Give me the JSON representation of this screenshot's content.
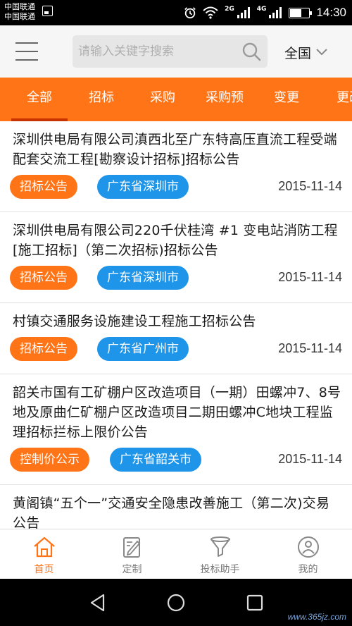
{
  "status_bar": {
    "carrier_1": "中国联通",
    "carrier_2": "中国联通",
    "network_1": "2G",
    "network_2": "4G",
    "battery_level": 0.55,
    "time": "14:30"
  },
  "header": {
    "search_placeholder": "请输入关键字搜索",
    "region": "全国"
  },
  "tabs": [
    {
      "label": "全部",
      "active": true
    },
    {
      "label": "招标",
      "active": false
    },
    {
      "label": "采购",
      "active": false
    },
    {
      "label": "采购预",
      "active": false
    },
    {
      "label": "变更",
      "active": false
    },
    {
      "label": "更改",
      "active": false
    }
  ],
  "items": [
    {
      "title": "深圳供电局有限公司滇西北至广东特高压直流工程受端配套交流工程[勘察设计招标]招标公告",
      "type": "招标公告",
      "region": "广东省深圳市",
      "date": "2015-11-14"
    },
    {
      "title": "深圳供电局有限公司220千伏桂湾 #1 变电站消防工程[施工招标]（第二次招标)招标公告",
      "type": "招标公告",
      "region": "广东省深圳市",
      "date": "2015-11-14"
    },
    {
      "title": "村镇交通服务设施建设工程施工招标公告",
      "type": "招标公告",
      "region": "广东省广州市",
      "date": "2015-11-14"
    },
    {
      "title": "韶关市国有工矿棚户区改造项目（一期）田螺冲7、8号地及原曲仁矿棚户区改造项目二期田螺冲C地块工程监理招标拦标上限价公告",
      "type": "控制价公示",
      "region": "广东省韶关市",
      "date": "2015-11-14"
    },
    {
      "title": "黄阁镇“五个一”交通安全隐患改善施工（第二次)交易公告",
      "type": "",
      "region": "",
      "date": ""
    }
  ],
  "bottom_nav": [
    {
      "label": "首页",
      "icon": "home-icon",
      "active": true
    },
    {
      "label": "定制",
      "icon": "edit-icon",
      "active": false
    },
    {
      "label": "投标助手",
      "icon": "funnel-icon",
      "active": false
    },
    {
      "label": "我的",
      "icon": "profile-icon",
      "active": false
    }
  ],
  "watermark": "www.365jz.com",
  "colors": {
    "accent": "#ff7417",
    "region_badge": "#1e95e8",
    "tab_underline": "#c93300"
  }
}
